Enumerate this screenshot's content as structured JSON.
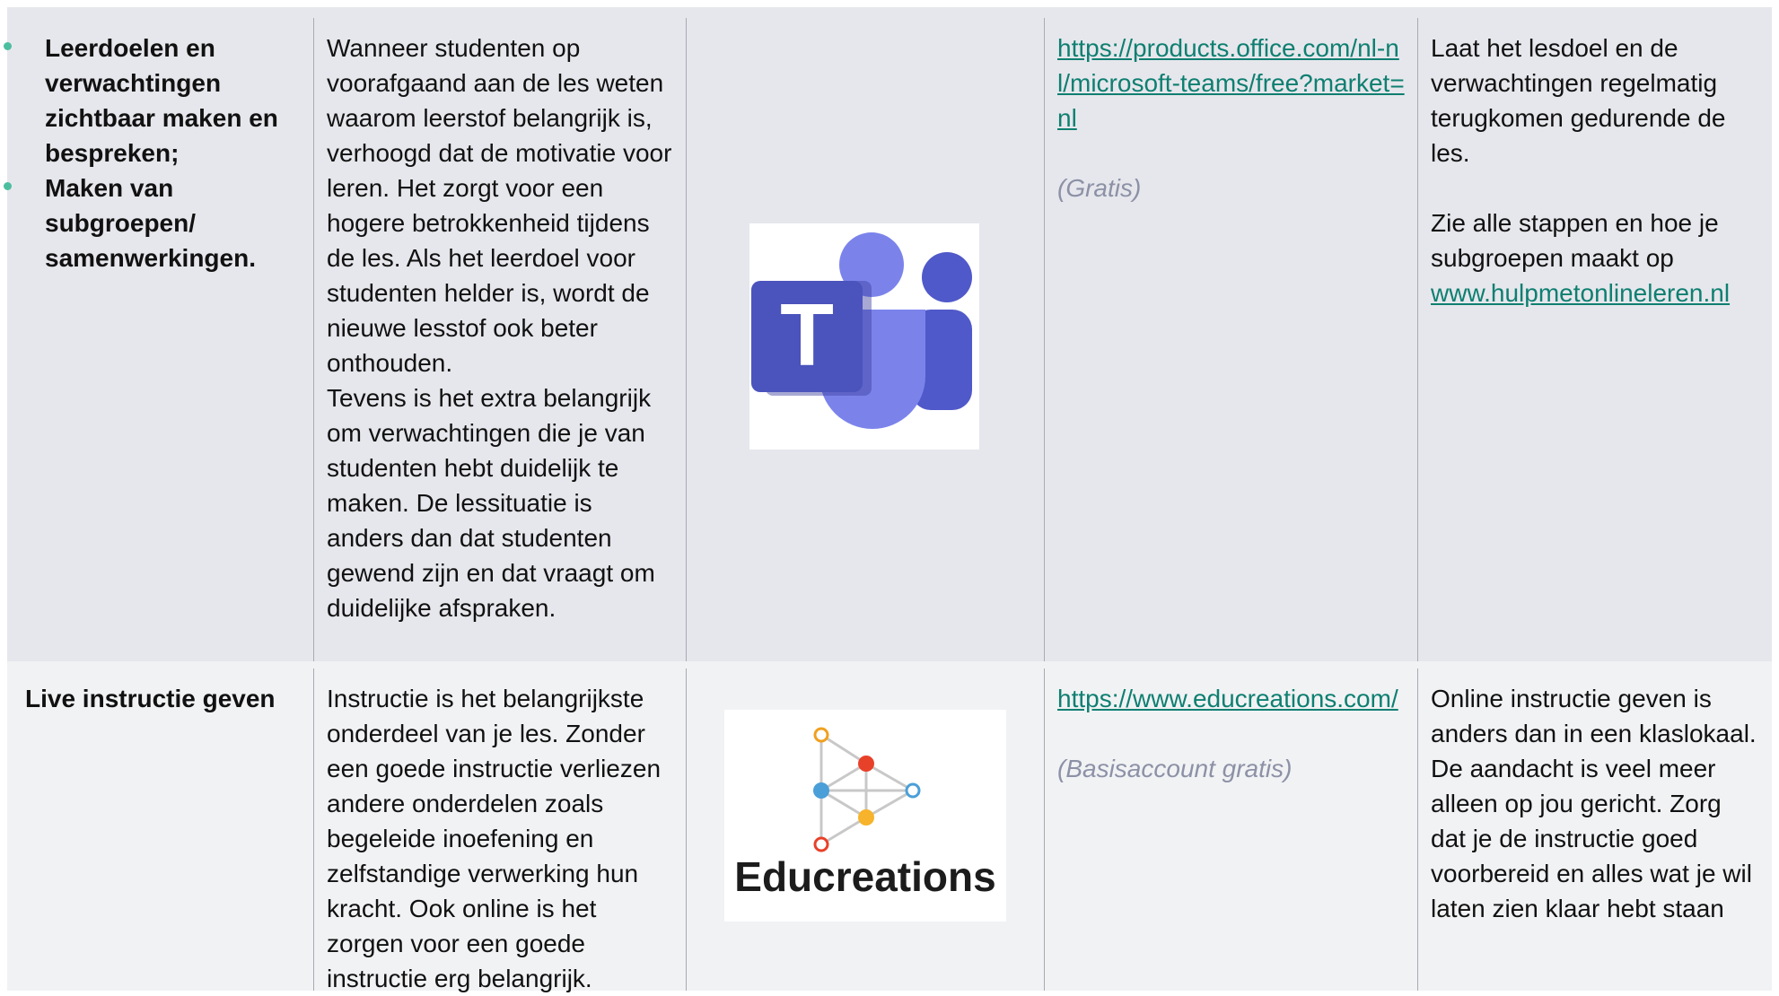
{
  "rows": [
    {
      "col1_items": [
        "Leerdoelen en verwachtingen zichtbaar maken en bespreken;",
        "Maken van subgroepen/ samenwerkingen."
      ],
      "col2_paragraphs": [
        "Wanneer studenten op voorafgaand aan de les weten waarom leerstof belangrijk is, verhoogd dat de motivatie voor leren. Het zorgt voor een hogere betrokkenheid tijdens de les. Als het leerdoel voor studenten helder is, wordt de nieuwe lesstof ook beter onthouden.",
        "Tevens is het extra belangrijk om verwachtingen die je van studenten hebt duidelijk te maken. De lessituatie is anders dan dat studenten gewend zijn en dat vraagt om duidelijke afspraken."
      ],
      "col3_logo": {
        "icon": "microsoft-teams-logo",
        "letter": "T",
        "colors": {
          "dark": "#4b53bc",
          "mid": "#5059c9",
          "light": "#7b83eb",
          "darkest": "#3c3f9e"
        }
      },
      "col4_link": "https://products.office.com/nl-nl/microsoft-teams/free?market=nl",
      "col4_price": "(Gratis)",
      "col5_text_1": "Laat het lesdoel en de verwachtingen regelmatig terugkomen gedurende de les.",
      "col5_text_2": "Zie alle stappen en hoe je subgroepen maakt op",
      "col5_link": "www.hulpmetonlineleren.nl"
    },
    {
      "col1_title": "Live instructie geven",
      "col2_text": "Instructie is het belangrijkste onderdeel van je les. Zonder een goede instructie verliezen andere onderdelen zoals begeleide inoefening en zelfstandige verwerking hun kracht. Ook online is het zorgen voor een goede instructie erg belangrijk.",
      "col3_logo": {
        "icon": "educreations-logo",
        "word": "Educreations",
        "colors": {
          "orange": "#f0a020",
          "red": "#e8412a",
          "blue": "#4a9fd8",
          "yellow": "#f7b32b",
          "line": "#c8c8c8"
        }
      },
      "col4_link": "https://www.educreations.com/",
      "col4_price": "(Basisaccount gratis)",
      "col5_text": "Online instructie geven is anders dan in een klaslokaal. De aandacht is veel meer alleen op jou gericht. Zorg dat je de instructie goed voorbereid en alles wat je wil laten zien klaar hebt staan"
    }
  ],
  "colors": {
    "row1_bg": "#e6e7ec",
    "row2_bg": "#f1f2f4",
    "link": "#0e7f71",
    "price": "#8c91a6",
    "bullet": "#4cbe9f",
    "divider": "#a9abb2"
  }
}
